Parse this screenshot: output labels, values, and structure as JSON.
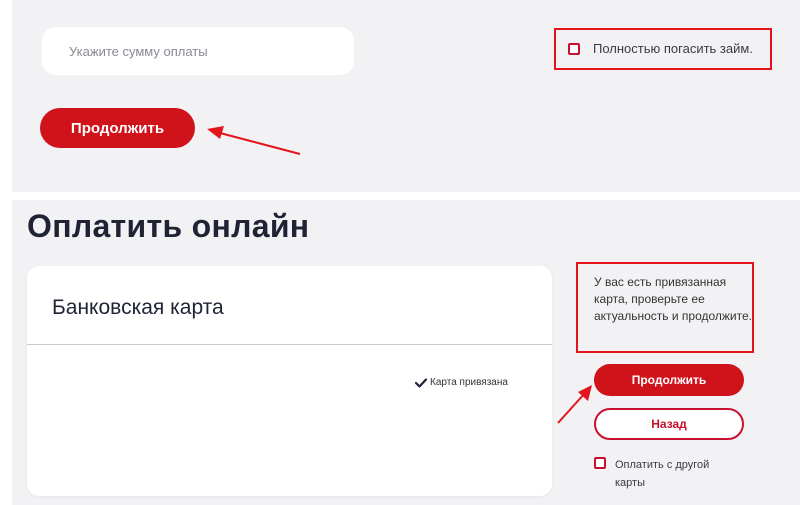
{
  "payment": {
    "amount_placeholder": "Укажите сумму оплаты",
    "full_repay_label": "Полностью погасить займ.",
    "continue_label": "Продолжить"
  },
  "online": {
    "title": "Оплатить онлайн",
    "card": {
      "title": "Банковская карта",
      "status": "Карта привязана"
    },
    "note": "У вас есть привязанная карта, проверьте ее актуальность и продолжите.",
    "continue_label": "Продолжить",
    "back_label": "Назад",
    "other_card_label": "Оплатить с другой карты"
  },
  "colors": {
    "accent": "#d0121b",
    "annotation": "#e3141b",
    "panel_bg": "#f2f2f5"
  }
}
